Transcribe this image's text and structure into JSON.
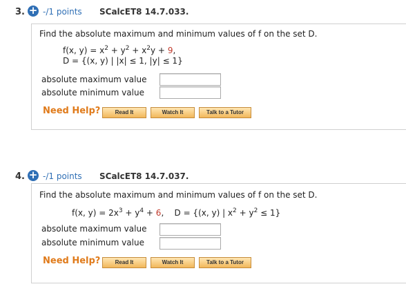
{
  "questions": [
    {
      "number": "3.",
      "points": "-/1 points",
      "code": "SCalcET8 14.7.033.",
      "statement": "Find the absolute maximum and minimum values of f on the set D.",
      "function": "f(x, y) = x² + y² + x²y + 9,",
      "domain_set": "D = {(x, y) | |x| ≤ 1, |y| ≤ 1}",
      "max_label": "absolute maximum value",
      "min_label": "absolute minimum value",
      "max_value": "",
      "min_value": "",
      "need_help": "Need Help?",
      "buttons": [
        "Read It",
        "Watch It",
        "Talk to a Tutor"
      ]
    },
    {
      "number": "4.",
      "points": "-/1 points",
      "code": "SCalcET8 14.7.037.",
      "statement": "Find the absolute maximum and minimum values of f on the set D.",
      "function": "f(x, y) = 2x³ + y⁴ + 6,   D = {(x, y) | x² + y² ≤ 1}",
      "max_label": "absolute maximum value",
      "min_label": "absolute minimum value",
      "max_value": "",
      "min_value": "",
      "need_help": "Need Help?",
      "buttons": [
        "Read It",
        "Watch It",
        "Talk to a Tutor"
      ]
    }
  ],
  "colors": {
    "accent": "#2f6fb5",
    "need_help": "#e07b1b",
    "constant": "#c0392b"
  }
}
